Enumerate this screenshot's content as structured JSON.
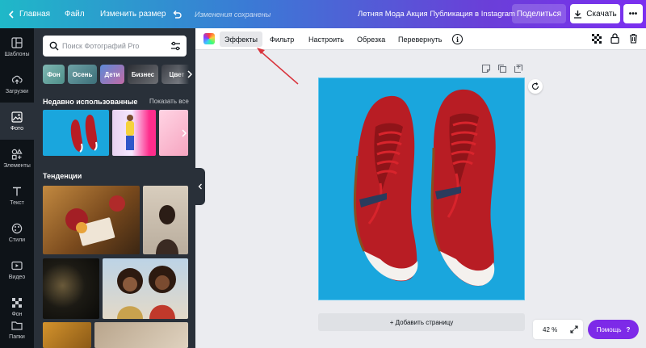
{
  "topbar": {
    "home_label": "Главная",
    "file_label": "Файл",
    "resize_label": "Изменить размер",
    "saved_text": "Изменения сохранены",
    "doc_title": "Летняя Мода Акция Публикация в Instagram",
    "share_label": "Поделиться",
    "download_label": "Скачать",
    "more_label": "•••"
  },
  "rail": {
    "items": [
      {
        "label": "Шаблоны",
        "icon": "templates-icon"
      },
      {
        "label": "Загрузки",
        "icon": "upload-icon"
      },
      {
        "label": "Фото",
        "icon": "photo-icon"
      },
      {
        "label": "Элементы",
        "icon": "elements-icon"
      },
      {
        "label": "Текст",
        "icon": "text-icon"
      },
      {
        "label": "Стили",
        "icon": "styles-icon"
      },
      {
        "label": "Видео",
        "icon": "video-icon"
      },
      {
        "label": "Фон",
        "icon": "background-icon"
      },
      {
        "label": "Папки",
        "icon": "folder-icon"
      }
    ]
  },
  "panel": {
    "search_placeholder": "Поиск Фотографий Pro",
    "chips": [
      "Фон",
      "Осень",
      "Дети",
      "Бизнес",
      "Цвет"
    ],
    "recent_title": "Недавно использованные",
    "show_all": "Показать все",
    "trends_title": "Тенденции"
  },
  "toolbar": {
    "effects": "Эффекты",
    "filter": "Фильтр",
    "adjust": "Настроить",
    "crop": "Обрезка",
    "flip": "Перевернуть",
    "info": "i"
  },
  "canvas": {
    "add_page": "+ Добавить страницу",
    "zoom": "42 %",
    "help": "Помощь",
    "help_mark": "?"
  },
  "colors": {
    "accent": "#7d2ae8",
    "canvas_bg": "#1aa6dd",
    "annotation_arrow": "#d9343d"
  }
}
